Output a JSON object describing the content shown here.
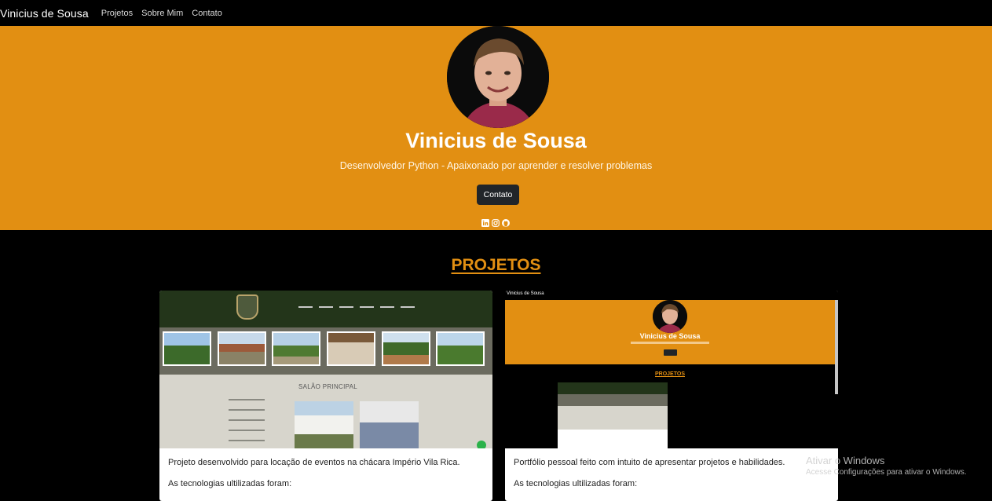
{
  "navbar": {
    "brand": "Vinicius de Sousa",
    "links": [
      "Projetos",
      "Sobre Mim",
      "Contato"
    ]
  },
  "hero": {
    "name": "Vinicius de Sousa",
    "subtitle": "Desenvolvedor Python - Apaixonado por aprender e resolver problemas",
    "contact_button": "Contato",
    "socials": [
      "linkedin-icon",
      "instagram-icon",
      "github-icon"
    ]
  },
  "projects": {
    "title": "PROJETOS",
    "cards": [
      {
        "thumbnail_heading": "SALÃO PRINCIPAL",
        "description": "Projeto desenvolvido para locação de eventos na chácara Império Vila Rica.",
        "tech_label": "As tecnologias ultilizadas foram:"
      },
      {
        "thumbnail_brand": "Vinicius de Sousa",
        "thumbnail_name": "Vinicius de Sousa",
        "thumbnail_section": "PROJETOS",
        "description": "Portfólio pessoal feito com intuito de apresentar projetos e habilidades.",
        "tech_label": "As tecnologias ultilizadas foram:"
      }
    ]
  },
  "watermark": {
    "title": "Ativar o Windows",
    "subtitle": "Acesse Configurações para ativar o Windows."
  },
  "colors": {
    "accent": "#e28f12",
    "background": "#000000",
    "button": "#212529"
  }
}
